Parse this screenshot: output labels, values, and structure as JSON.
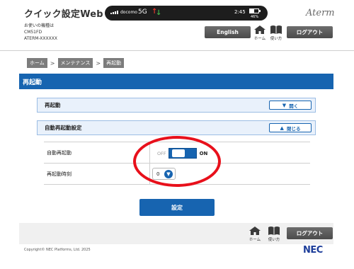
{
  "header": {
    "app_title": "クイック設定Web",
    "device_label": "お使いの機種は",
    "device_model": "CM51FD",
    "device_id": "ATERM-XXXXXX",
    "brand": "Aterm"
  },
  "status_bar": {
    "carrier": "docomo",
    "network": "5G",
    "time": "2:45",
    "battery_pct": "46%"
  },
  "nav": {
    "language_label": "English",
    "home_label": "ホーム",
    "help_label": "使い方",
    "logout_label": "ログアウト"
  },
  "breadcrumb": [
    "ホーム",
    "メンテナンス",
    "再起動"
  ],
  "breadcrumb_sep": ">",
  "section": {
    "title": "再起動"
  },
  "accordions": [
    {
      "title": "再起動",
      "toggle_label": "開く",
      "state": "collapsed"
    },
    {
      "title": "自動再起動設定",
      "toggle_label": "閉じる",
      "state": "expanded"
    }
  ],
  "settings": {
    "auto_restart": {
      "label": "自動再起動",
      "off_label": "OFF",
      "on_label": "ON",
      "value": "ON"
    },
    "restart_time": {
      "label": "再起動時刻",
      "value": "0"
    }
  },
  "submit_label": "設定",
  "footer": {
    "home_label": "ホーム",
    "help_label": "使い方",
    "logout_label": "ログアウト",
    "copyright": "Copyright© NEC Platforms, Ltd. 2025",
    "logo": "NEC"
  },
  "colors": {
    "accent": "#1764b0",
    "annotation": "#e8101b",
    "dark_button": "#555555"
  }
}
